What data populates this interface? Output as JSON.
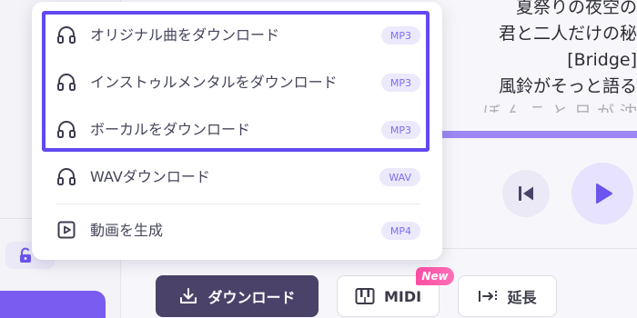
{
  "lyrics": {
    "lines": [
      "夏祭りの夜空の",
      "君と二人だけの秘",
      "[Bridge]",
      "風鈴がそっと語る",
      "ぼ ん こ と 日 が 沈"
    ]
  },
  "download_menu": {
    "items": [
      {
        "label": "オリジナル曲をダウンロード",
        "format": "MP3",
        "icon": "headphones-icon"
      },
      {
        "label": "インストゥルメンタルをダウンロード",
        "format": "MP3",
        "icon": "headphones-icon"
      },
      {
        "label": "ボーカルをダウンロード",
        "format": "MP3",
        "icon": "headphones-icon"
      },
      {
        "label": "WAVダウンロード",
        "format": "WAV",
        "icon": "headphones-icon"
      },
      {
        "label": "動画を生成",
        "format": "MP4",
        "icon": "video-icon"
      }
    ]
  },
  "toolbar": {
    "download_label": "ダウンロード",
    "midi_label": "MIDI",
    "midi_badge": "New",
    "extend_label": "延長"
  },
  "colors": {
    "accent": "#6149f0",
    "download_button": "#4a4269",
    "badge_bg": "#ebe9fb",
    "badge_text": "#7d6ff0",
    "new_badge": "#ff4fa3"
  }
}
